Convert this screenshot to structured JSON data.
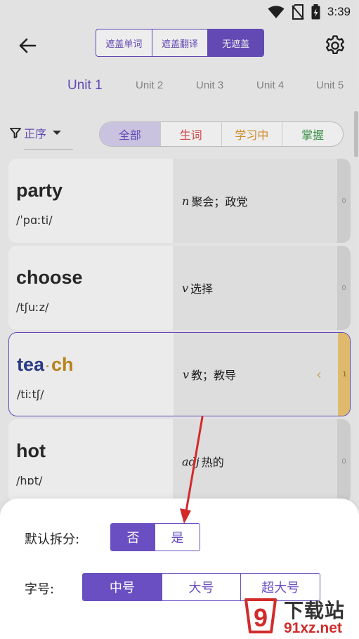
{
  "status_bar": {
    "time": "3:39",
    "icons": [
      "wifi-icon",
      "no-sim-icon",
      "battery-icon"
    ]
  },
  "header": {
    "back_icon": "arrow-left-icon",
    "settings_icon": "gear-icon",
    "cover_modes": [
      {
        "label": "遮盖单词",
        "active": false
      },
      {
        "label": "遮盖翻译",
        "active": false
      },
      {
        "label": "无遮盖",
        "active": true
      }
    ]
  },
  "unit_tabs": [
    {
      "label": "Unit 1",
      "active": true
    },
    {
      "label": "Unit 2",
      "active": false
    },
    {
      "label": "Unit 3",
      "active": false
    },
    {
      "label": "Unit 4",
      "active": false
    },
    {
      "label": "Unit 5",
      "active": false
    }
  ],
  "filter": {
    "sort_label": "正序",
    "filter_icon": "funnel-icon",
    "dropdown_icon": "caret-down-icon",
    "tabs": [
      {
        "label": "全部",
        "color": "#6a4fc2",
        "active": true
      },
      {
        "label": "生词",
        "color": "#e04a4a",
        "active": false
      },
      {
        "label": "学习中",
        "color": "#e0962f",
        "active": false
      },
      {
        "label": "掌握",
        "color": "#3f9b4a",
        "active": false
      }
    ]
  },
  "words": [
    {
      "word": "party",
      "phonetic": "/ˈpɑːti/",
      "pos": "n",
      "meaning": "聚会；政党",
      "count": "0"
    },
    {
      "word": "choose",
      "phonetic": "/tʃuːz/",
      "pos": "v",
      "meaning": "选择",
      "count": "0"
    },
    {
      "word_part1": "tea",
      "word_sep": "·",
      "word_part2": "ch",
      "phonetic": "/tiːtʃ/",
      "pos": "v",
      "meaning": "教；教导",
      "count": "1",
      "chevron": "‹"
    },
    {
      "word": "hot",
      "phonetic": "/hɒt/",
      "pos": "adj",
      "meaning": "热的",
      "count": "0"
    }
  ],
  "sheet": {
    "split_label": "默认拆分:",
    "split_options": [
      {
        "label": "否",
        "active": true
      },
      {
        "label": "是",
        "active": false
      }
    ],
    "size_label": "字号:",
    "size_options": [
      {
        "label": "中号",
        "active": true
      },
      {
        "label": "大号",
        "active": false
      },
      {
        "label": "超大号",
        "active": false
      }
    ]
  },
  "watermark": {
    "title": "下载站",
    "url": "91xz.net",
    "badge_text": "9"
  },
  "colors": {
    "accent": "#6a4fc2",
    "learning_strip": "#f2c975",
    "annotation_arrow": "#d42a2a"
  }
}
